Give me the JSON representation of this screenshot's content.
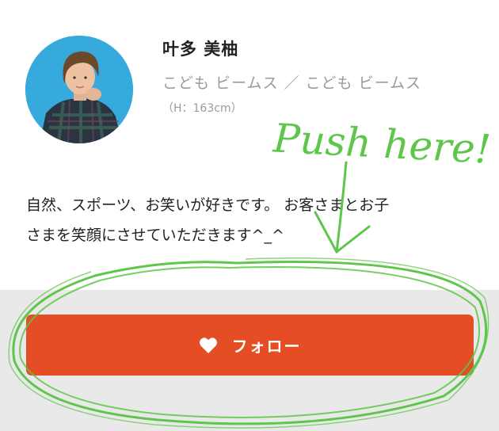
{
  "profile": {
    "name": "叶多 美柚",
    "shop": "こども ビームス ／ こども ビームス",
    "height": "（H：163cm）",
    "avatar_icon": "staff-photo"
  },
  "bio": {
    "line1": "自然、スポーツ、お笑いが好きです。 お客さまとお子",
    "line2": "さまを笑顔にさせていただきます^_^"
  },
  "follow_button": {
    "label": "フォロー",
    "icon": "heart-icon",
    "color": "#e54d24"
  },
  "annotation": {
    "text": "Push here!",
    "color": "#5ec64a"
  }
}
